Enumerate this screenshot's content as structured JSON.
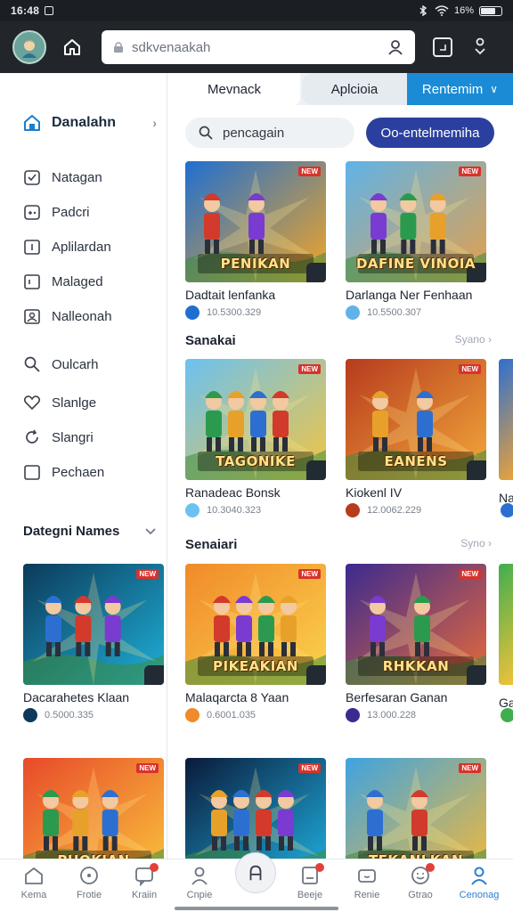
{
  "status_bar": {
    "time": "16:48",
    "battery": "16%"
  },
  "browser": {
    "url": "sdkvenaakah"
  },
  "sidebar": {
    "items": [
      {
        "label": "Danalahn",
        "icon": "home-icon",
        "active": true
      },
      {
        "label": "Natagan",
        "icon": "checklist-icon"
      },
      {
        "label": "Padcri",
        "icon": "gamepad-icon"
      },
      {
        "label": "Aplilardan",
        "icon": "app-icon"
      },
      {
        "label": "Malaged",
        "icon": "square-icon"
      },
      {
        "label": "Nalleonah",
        "icon": "user-card-icon"
      },
      {
        "label": "Oulcarh",
        "icon": "search-icon"
      },
      {
        "label": "Slanlge",
        "icon": "heart-icon"
      },
      {
        "label": "Slangri",
        "icon": "refresh-icon"
      },
      {
        "label": "Pechaen",
        "icon": "checkbox-icon"
      }
    ],
    "category_header": "Dategni Names"
  },
  "tabs": [
    "Mevnack",
    "Aplcioia",
    "Rentemim"
  ],
  "search": {
    "placeholder": "pencagain"
  },
  "action_button": "Oo-entelmemiha",
  "sections": [
    {
      "title": "Sanakai",
      "see_more": "Syano"
    },
    {
      "title": "Senaiari",
      "see_more": "Syno"
    }
  ],
  "cards": [
    {
      "title": "Dadtait lenfanka",
      "meta": "10.5300.329",
      "art_text": "PENIKAN",
      "colors": [
        "#1f6fd1",
        "#f5a623"
      ]
    },
    {
      "title": "Darlanga Ner Fenhaan",
      "meta": "10.5500.307",
      "art_text": "DAFINE VINOIA",
      "colors": [
        "#5fb3e8",
        "#e5a04b"
      ]
    },
    {
      "title": "Ranadeac Bonsk",
      "meta": "10.3040.323",
      "art_text": "TAGONIKE",
      "colors": [
        "#6bc2f0",
        "#f4c542"
      ]
    },
    {
      "title": "Kiokenl IV",
      "meta": "12.0062.229",
      "art_text": "EANENS",
      "colors": [
        "#b73b1e",
        "#f2a93b"
      ]
    },
    {
      "title": "Dacarahetes Klaan",
      "meta": "0.5000.335",
      "art_text": "",
      "colors": [
        "#0c3a5a",
        "#1fb0d8"
      ]
    },
    {
      "title": "Malaqarcta 8 Yaan",
      "meta": "0.6001.035",
      "art_text": "PIKEAKIAN",
      "colors": [
        "#f08a2a",
        "#fbd34d"
      ]
    },
    {
      "title": "Berfesaran Ganan",
      "meta": "13.000.228",
      "art_text": "RHKKAN",
      "colors": [
        "#3c2a8f",
        "#e86a3a"
      ]
    },
    {
      "title": "",
      "meta": "",
      "art_text": "PHOKIAN",
      "colors": [
        "#e84a2a",
        "#f9c23c"
      ]
    },
    {
      "title": "",
      "meta": "",
      "art_text": "",
      "colors": [
        "#0a1a3a",
        "#1fb0e0"
      ]
    },
    {
      "title": "",
      "meta": "",
      "art_text": "TEKANLKAN",
      "colors": [
        "#3fa3e0",
        "#f3b93a"
      ]
    }
  ],
  "partial_cards": [
    {
      "title": "Na",
      "meta": ""
    },
    {
      "title": "Ga",
      "meta": ""
    }
  ],
  "bottom_nav": [
    {
      "label": "Kema",
      "icon": "home-icon"
    },
    {
      "label": "Frotie",
      "icon": "compass-icon"
    },
    {
      "label": "Kraiin",
      "icon": "chat-icon"
    },
    {
      "label": "Cnpie",
      "icon": "person-icon"
    },
    {
      "label": "",
      "icon": "center-fab-icon"
    },
    {
      "label": "Beeje",
      "icon": "doc-icon"
    },
    {
      "label": "Renie",
      "icon": "controller-icon"
    },
    {
      "label": "Gtrao",
      "icon": "smile-icon"
    },
    {
      "label": "Cenonag",
      "icon": "account-icon",
      "active": true
    }
  ]
}
